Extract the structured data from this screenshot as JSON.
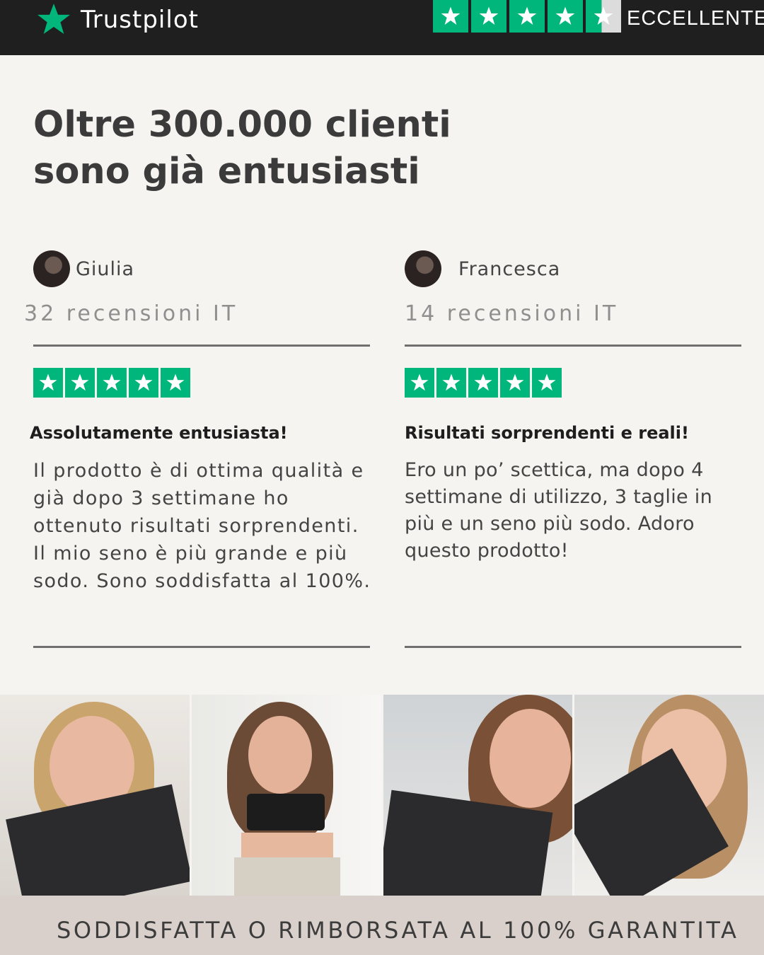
{
  "header": {
    "brand": "Trustpilot",
    "rating_stars": 4.5,
    "rating_label": "ECCELLENTE",
    "accent_color": "#00b67a"
  },
  "headline": {
    "line1": "Oltre 300.000 clienti",
    "line2": "sono già entusiasti"
  },
  "reviews": [
    {
      "name": "Giulia",
      "count": "32 recensioni IT",
      "stars": 5,
      "title": "Assolutamente entusiasta!",
      "body": "Il prodotto è di ottima qualità e già dopo 3 settimane ho ottenuto risultati sorprendenti. Il mio seno è più grande e più sodo. Sono soddisfatta al 100%."
    },
    {
      "name": "Francesca",
      "count": "14 recensioni IT",
      "stars": 5,
      "title": "Risultati sorprendenti e reali!",
      "body": "Ero un po’ scettica, ma dopo 4 settimane di utilizzo, 3 taglie in più e un seno più sodo. Adoro questo prodotto!"
    }
  ],
  "photos": [
    "customer-photo",
    "customer-photo",
    "customer-photo",
    "customer-photo"
  ],
  "guarantee": "SODDISFATTA O RIMBORSATA AL 100% GARANTITA"
}
